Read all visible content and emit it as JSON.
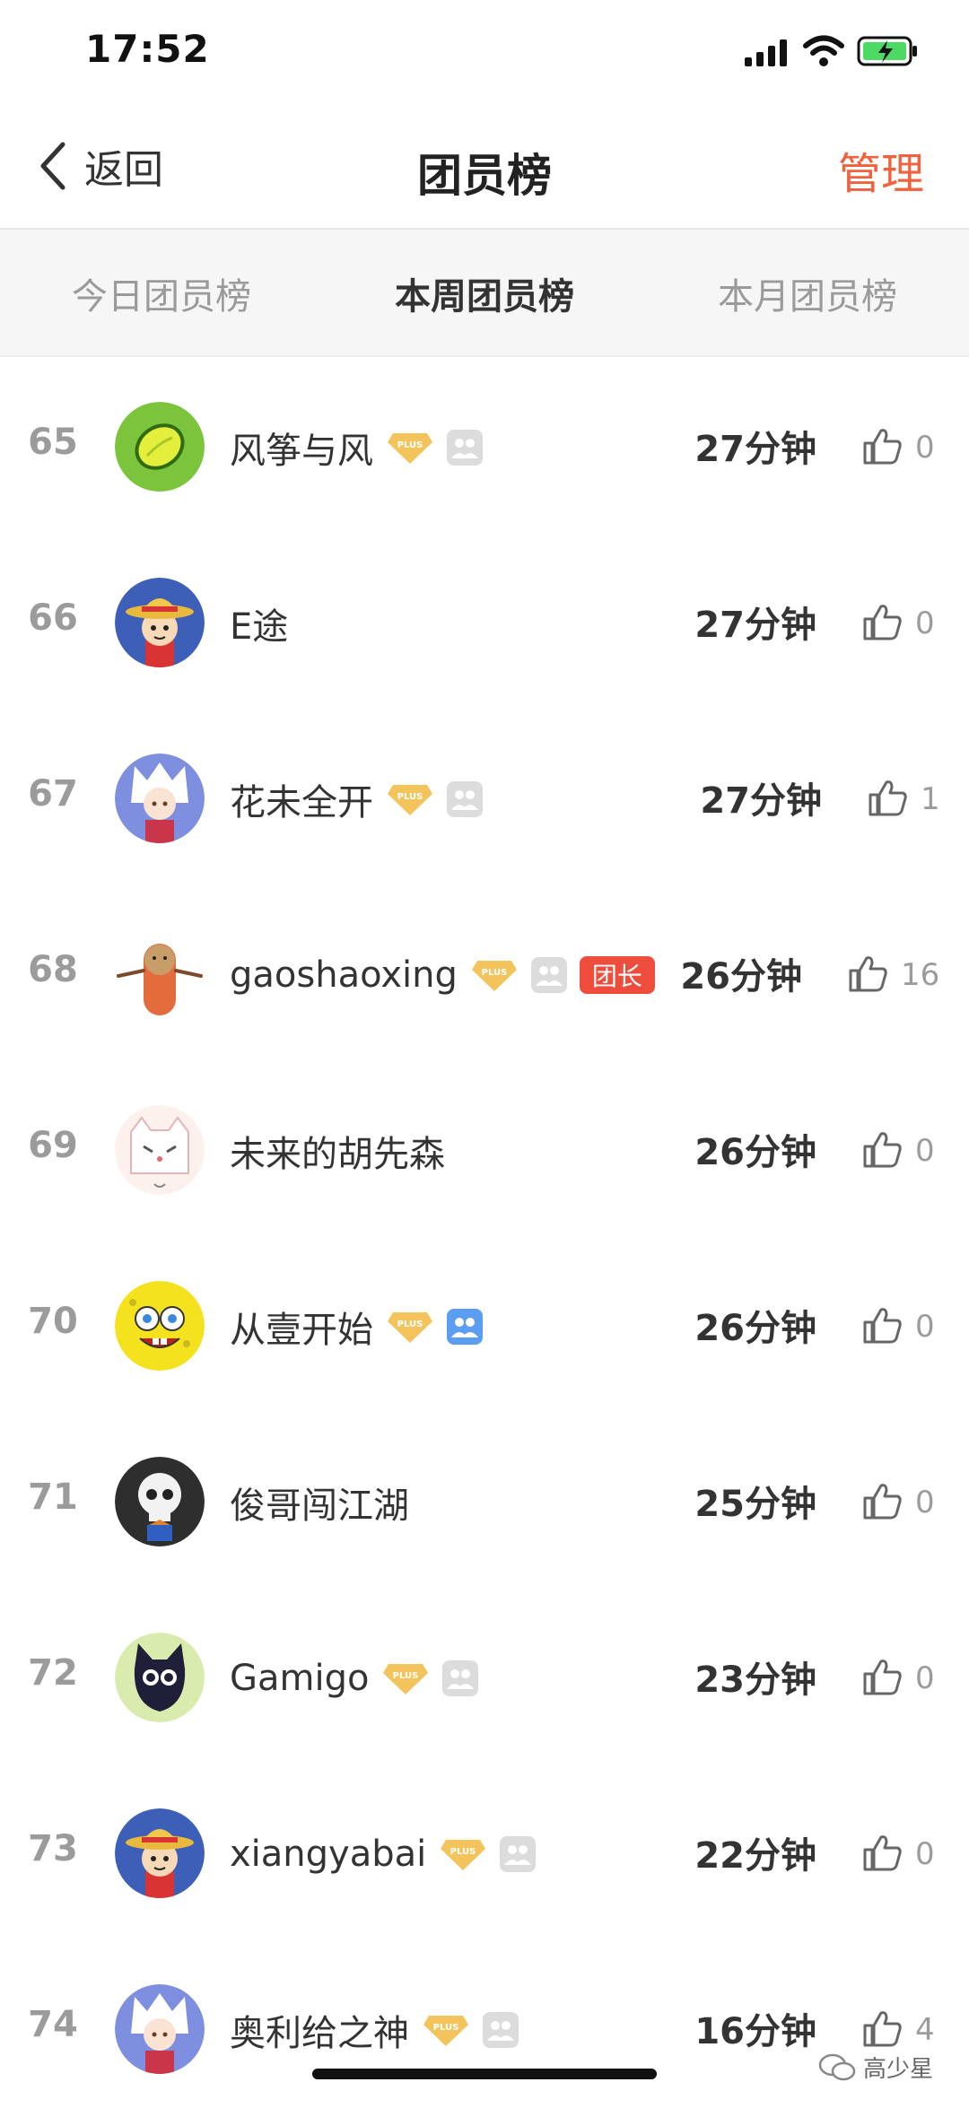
{
  "status_bar": {
    "time": "17:52"
  },
  "nav": {
    "back_label": "返回",
    "title": "团员榜",
    "manage_label": "管理"
  },
  "tabs": [
    {
      "label": "今日团员榜",
      "active": false
    },
    {
      "label": "本周团员榜",
      "active": true
    },
    {
      "label": "本月团员榜",
      "active": false
    }
  ],
  "colors": {
    "accent": "#f0623d",
    "leader_badge": "#ee4d3e",
    "plus_badge": "#f3c45c",
    "group_badge_active": "#5b9df0",
    "group_badge_inactive": "#dcdcdc"
  },
  "members": [
    {
      "rank": "65",
      "name": "风筝与风",
      "plus": true,
      "group": "inactive",
      "leader": false,
      "duration": "27分钟",
      "likes": "0",
      "avatar": "lemon-avatar"
    },
    {
      "rank": "66",
      "name": "E途",
      "plus": false,
      "group": "none",
      "leader": false,
      "duration": "27分钟",
      "likes": "0",
      "avatar": "straw-hat-avatar"
    },
    {
      "rank": "67",
      "name": "花未全开",
      "plus": true,
      "group": "inactive",
      "leader": false,
      "duration": "27分钟",
      "likes": "1",
      "avatar": "white-hair-avatar"
    },
    {
      "rank": "68",
      "name": "gaoshaoxing",
      "plus": true,
      "group": "inactive",
      "leader": true,
      "leader_label": "团长",
      "duration": "26分钟",
      "likes": "16",
      "avatar": "cylinder-avatar"
    },
    {
      "rank": "69",
      "name": "未来的胡先森",
      "plus": false,
      "group": "none",
      "leader": false,
      "duration": "26分钟",
      "likes": "0",
      "avatar": "cat-avatar"
    },
    {
      "rank": "70",
      "name": "从壹开始",
      "plus": true,
      "group": "active",
      "leader": false,
      "duration": "26分钟",
      "likes": "0",
      "avatar": "sponge-avatar"
    },
    {
      "rank": "71",
      "name": "俊哥闯江湖",
      "plus": false,
      "group": "none",
      "leader": false,
      "duration": "25分钟",
      "likes": "0",
      "avatar": "skull-avatar"
    },
    {
      "rank": "72",
      "name": "Gamigo",
      "plus": true,
      "group": "inactive",
      "leader": false,
      "duration": "23分钟",
      "likes": "0",
      "avatar": "black-cat-avatar"
    },
    {
      "rank": "73",
      "name": "xiangyabai",
      "plus": true,
      "group": "inactive",
      "leader": false,
      "duration": "22分钟",
      "likes": "0",
      "avatar": "straw-hat-avatar"
    },
    {
      "rank": "74",
      "name": "奥利给之神",
      "plus": true,
      "group": "inactive",
      "leader": false,
      "duration": "16分钟",
      "likes": "4",
      "avatar": "white-hair-avatar"
    }
  ],
  "watermark": {
    "text": "高少星"
  }
}
